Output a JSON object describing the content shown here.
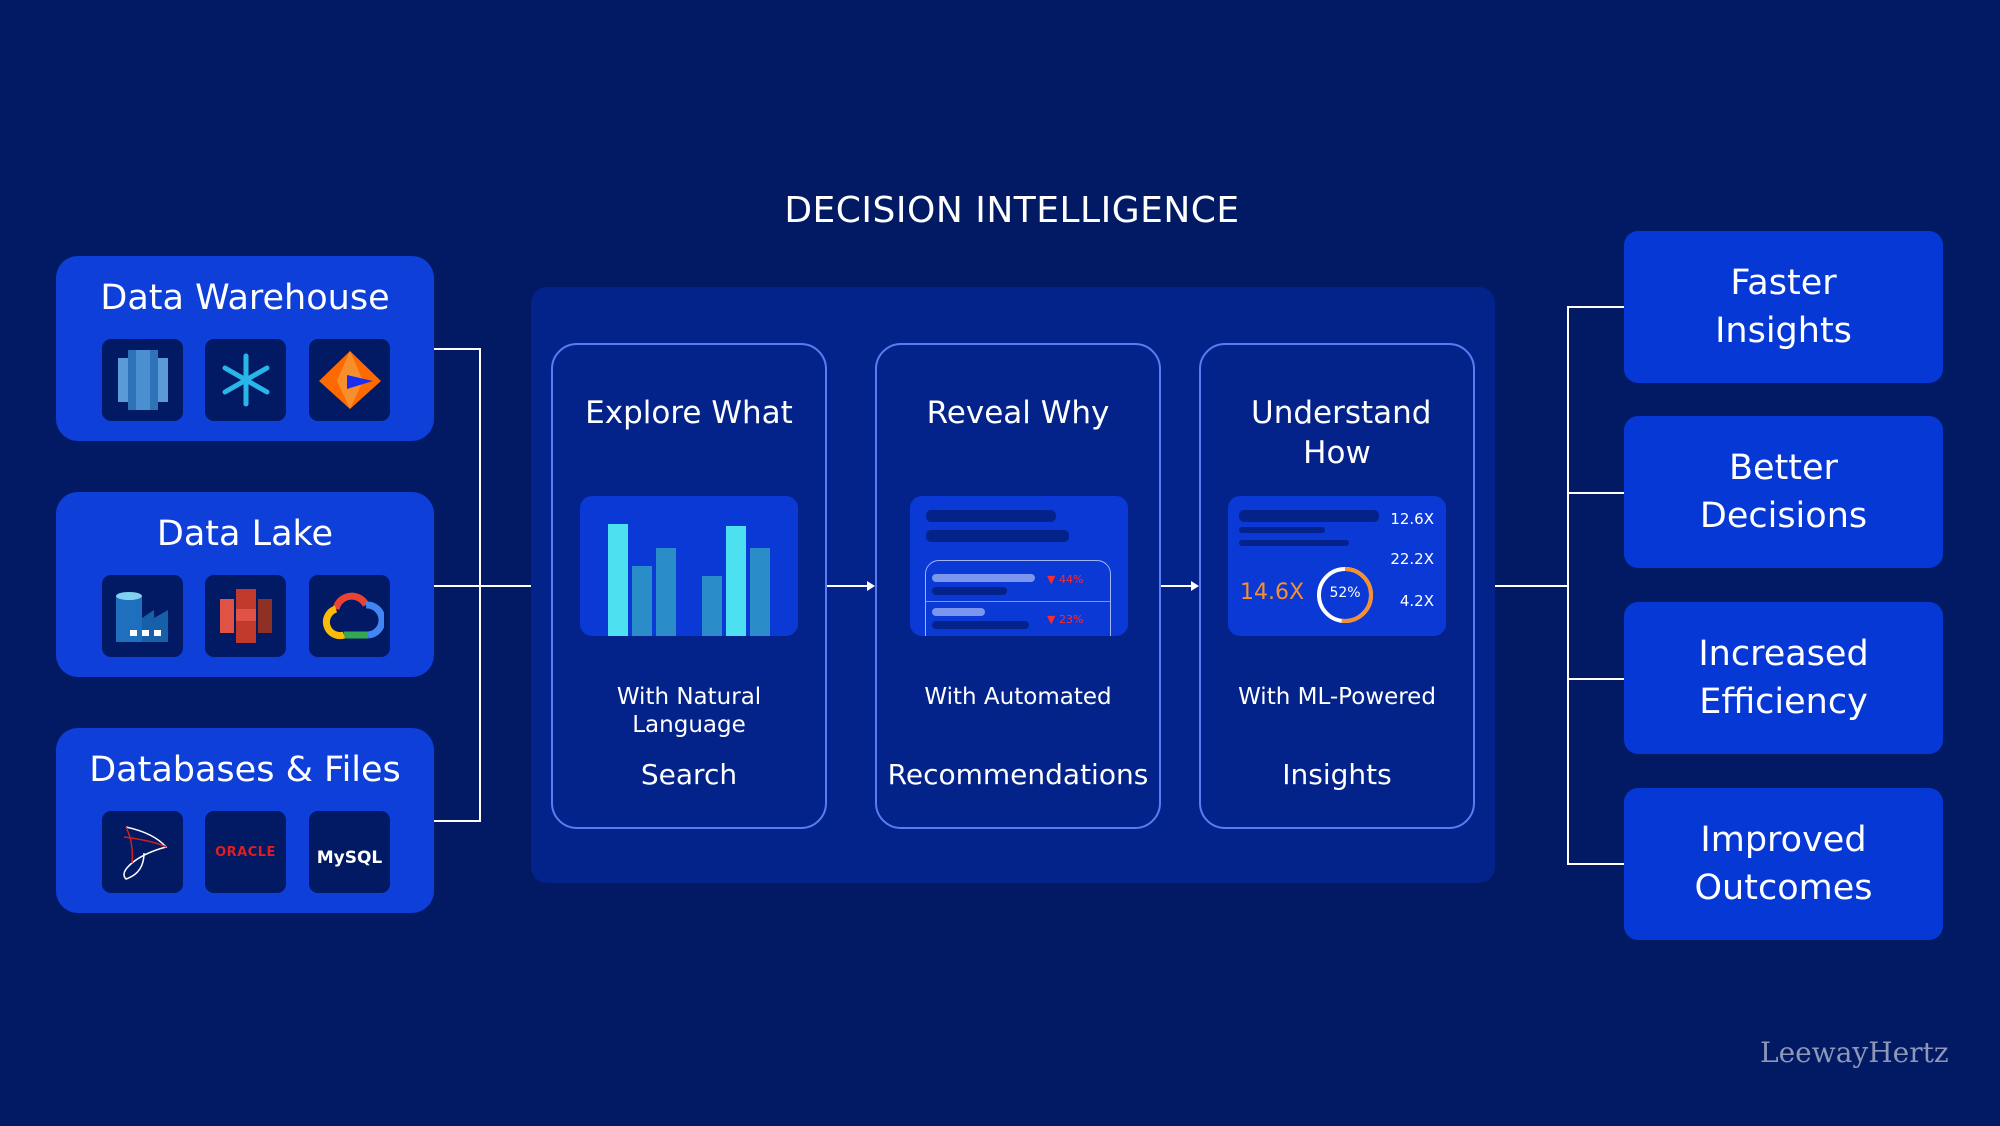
{
  "title": "DECISION INTELLIGENCE",
  "sources": [
    {
      "label": "Data Warehouse",
      "icons": [
        "amazon-redshift-icon",
        "snowflake-icon",
        "informatica-icon"
      ]
    },
    {
      "label": "Data Lake",
      "icons": [
        "azure-data-factory-icon",
        "amazon-s3-icon",
        "google-cloud-icon"
      ]
    },
    {
      "label": "Databases & Files",
      "icons": [
        "sql-server-icon",
        "oracle-icon",
        "mysql-icon"
      ],
      "oracle_text": "ORACLE",
      "mysql_text": "MySQL"
    }
  ],
  "stages": [
    {
      "title": "Explore What",
      "subtitle": "With Natural Language",
      "bottom": "Search"
    },
    {
      "title": "Reveal Why",
      "subtitle": "With Automated",
      "bottom": "Recommendations",
      "metrics": [
        "44%",
        "23%"
      ]
    },
    {
      "title": "Understand How",
      "subtitle": "With ML-Powered",
      "bottom": "Insights",
      "big_value": "14.6X",
      "gauge": "52%",
      "gauge_fraction": 0.52,
      "values": [
        "12.6X",
        "22.2X",
        "4.2X"
      ]
    }
  ],
  "outcomes": [
    "Faster Insights",
    "Better Decisions",
    "Increased Efficiency",
    "Improved Outcomes"
  ],
  "watermark": "LeewayHertz",
  "colors": {
    "background": "#011a63",
    "box": "#0f3fd9",
    "accent_orange": "#f7902c",
    "down_red": "#ff2a2a",
    "bar_light": "#4de0f0",
    "bar_dark": "#2a8cc8"
  }
}
